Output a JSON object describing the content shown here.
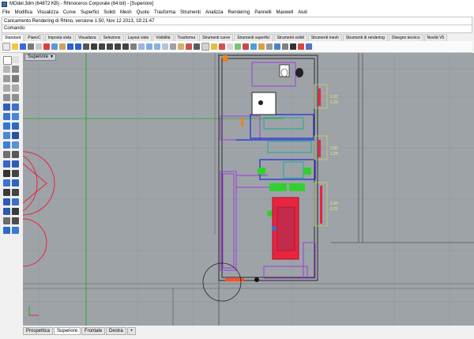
{
  "window": {
    "title": "MOdel.3dm (64872 KB) - Rhinoceros Corporate (64 bit) - [Superiore]"
  },
  "menu": [
    "File",
    "Modifica",
    "Visualizza",
    "Curve",
    "Superfici",
    "Solidi",
    "Mesh",
    "Quote",
    "Trasforma",
    "Strumenti",
    "Analizza",
    "Rendering",
    "Pannelli",
    "Maxwell",
    "Aiuti"
  ],
  "command_history": "Caricamento Rendering di Rhino, versione 1.50, Nov 12 2013, 19:21:47",
  "command_prompt": {
    "label": "Comando:",
    "value": ""
  },
  "toolbar_tabs": [
    "Standard",
    "PianoC",
    "Imposta vista",
    "Visualizza",
    "Selezione",
    "Layout viste",
    "Visibilità",
    "Trasforma",
    "Strumenti curve",
    "Strumenti superfici",
    "Strumenti solidi",
    "Strumenti mesh",
    "Strumenti di rendering",
    "Disegno tecnico",
    "Novità V5"
  ],
  "active_toolbar_tab": "Standard",
  "viewport": {
    "name": "Superiore",
    "caret": "▾"
  },
  "dimensions": [
    {
      "a": "0.82",
      "b": "1.29"
    },
    {
      "a": "0.82",
      "b": "1.29"
    },
    {
      "a": "1.50",
      "b": "2.21"
    }
  ],
  "view_tabs": [
    "Prospettica",
    "Superiore",
    "Frontale",
    "Destra"
  ],
  "active_view_tab": "Superiore",
  "add_tab_symbol": "+",
  "colors": {
    "viewport_bg": "#9ea3a8",
    "purple": "#9b3dde",
    "blue": "#1e2bd6",
    "red": "#e8243f",
    "green": "#2fd12f",
    "yellow_dim": "#d8e04a"
  }
}
